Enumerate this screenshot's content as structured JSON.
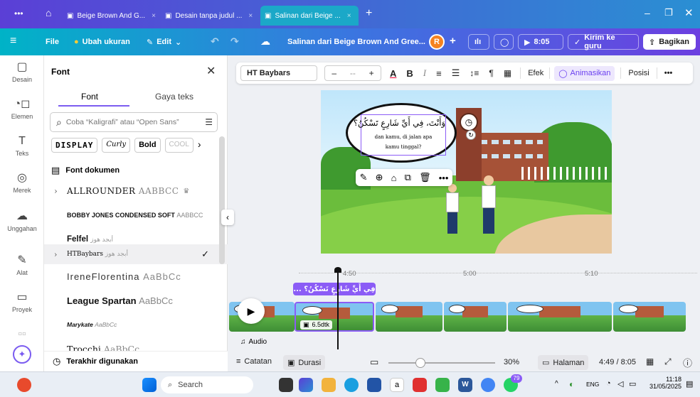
{
  "tabs": [
    {
      "label": "Beige Brown And G..."
    },
    {
      "label": "Desain tanpa judul ..."
    },
    {
      "label": "Salinan dari Beige ..."
    }
  ],
  "toolbar": {
    "file": "File",
    "resize": "Ubah ukuran",
    "edit": "Edit",
    "doc_title": "Salinan dari Beige Brown And Gree...",
    "avatar": "R",
    "play_time": "8:05",
    "send_teacher": "Kirim ke guru",
    "share": "Bagikan"
  },
  "rail": [
    {
      "label": "Desain"
    },
    {
      "label": "Elemen"
    },
    {
      "label": "Teks"
    },
    {
      "label": "Merek"
    },
    {
      "label": "Unggahan"
    },
    {
      "label": "Alat"
    },
    {
      "label": "Proyek"
    }
  ],
  "panel": {
    "title": "Font",
    "tab_font": "Font",
    "tab_style": "Gaya teks",
    "search_placeholder": "Coba “Kaligrafi” atau “Open Sans”",
    "chips": [
      "DISPLAY",
      "Curly",
      "Bold",
      "COOL"
    ],
    "section_label": "Font dokumen",
    "fonts": [
      {
        "name": "ALLROUNDER",
        "sample": "AABBCC"
      },
      {
        "name": "BOBBY JONES CONDENSED SOFT",
        "sample": "AABBCC"
      },
      {
        "name": "Felfel",
        "sample": "أبجد هوز"
      },
      {
        "name": "HTBaybars",
        "sample": "أبجد هوز"
      },
      {
        "name": "IreneFlorentina",
        "sample": "AaBbCc"
      },
      {
        "name": "League Spartan",
        "sample": "AaBbCc"
      },
      {
        "name": "Marykate",
        "sample": "AaBbCc"
      },
      {
        "name": "Trocchi",
        "sample": "AaBbCc"
      }
    ],
    "recent": "Terakhir digunakan"
  },
  "format": {
    "font": "HT Baybars",
    "size": "--",
    "effects": "Efek",
    "animate": "Animasikan",
    "position": "Posisi"
  },
  "slide": {
    "arabic": "وَأَنْتَ، فِي أَيِّ شَارِعٍ تَسْكُنُ؟",
    "translation": "dan kamu, di jalan apa kamu tinggal?"
  },
  "timeline": {
    "marks": [
      "4:50",
      "5:00",
      "5:10"
    ],
    "clip_label": "... فِي أَيِّ شَارِعٍ تَسْكُنُ؟",
    "clip_duration": "6.5dtk",
    "audio": "Audio"
  },
  "bottom": {
    "notes": "Catatan",
    "duration": "Durasi",
    "zoom": "30%",
    "zoom_value": 0.3,
    "pages": "Halaman",
    "time": "4:49 / 8:05"
  },
  "taskbar": {
    "search": "Search",
    "lang": "ENG",
    "clock": "11:18",
    "date": "31/05/2025",
    "badge": "79"
  }
}
